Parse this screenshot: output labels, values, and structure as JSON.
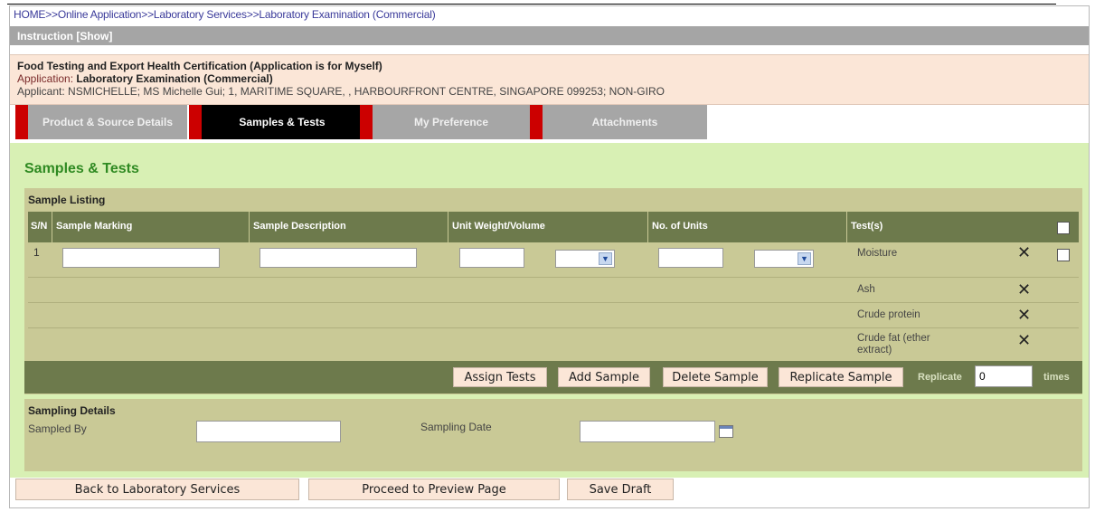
{
  "breadcrumb": "HOME>>Online Application>>Laboratory Services>>Laboratory Examination (Commercial)",
  "instruction_bar": "Instruction [Show]",
  "app_info": {
    "title": "Food Testing and Export Health Certification (Application is for Myself)",
    "application_label": "Application: ",
    "application_value": "Laboratory Examination (Commercial)",
    "applicant": "Applicant: NSMICHELLE; MS Michelle Gui; 1, MARITIME SQUARE, , HARBOURFRONT CENTRE, SINGAPORE 099253; NON-GIRO"
  },
  "tabs": [
    {
      "label": "Product & Source Details",
      "active": false
    },
    {
      "label": "Samples & Tests",
      "active": true
    },
    {
      "label": "My Preference",
      "active": false
    },
    {
      "label": "Attachments",
      "active": false
    }
  ],
  "section_title": "Samples & Tests",
  "sample_listing": {
    "legend": "Sample Listing",
    "columns": [
      "S/N",
      "Sample Marking",
      "Sample Description",
      "Unit Weight/Volume",
      "No. of Units",
      "Test(s)"
    ],
    "rows": [
      {
        "sn": "1",
        "sample_marking": "",
        "sample_description": "",
        "unit_weight": "",
        "unit_weight_unit": "",
        "no_of_units": "",
        "no_of_units_unit": "",
        "tests": [
          "Moisture",
          "Ash",
          "Crude protein",
          "Crude fat (ether extract)"
        ]
      }
    ]
  },
  "actions": {
    "assign_tests": "Assign Tests",
    "add_sample": "Add Sample",
    "delete_sample": "Delete Sample",
    "replicate_sample": "Replicate Sample",
    "replicate_label": "Replicate",
    "replicate_value": "0",
    "times_label": "times"
  },
  "sampling_details": {
    "legend": "Sampling Details",
    "sampled_by_label": "Sampled By",
    "sampled_by_value": "",
    "sampling_date_label": "Sampling Date",
    "sampling_date_value": ""
  },
  "footer": {
    "back": "Back to Laboratory Services",
    "proceed": "Proceed to Preview Page",
    "save_draft": "Save Draft"
  },
  "icons": {
    "remove_test": "close-x-icon",
    "dropdown": "chevron-down-icon",
    "calendar": "calendar-icon"
  },
  "colors": {
    "tab_active": "#000000",
    "tab_inactive": "#a6a6a6",
    "tab_marker": "#cc0000",
    "content_bg": "#d8f0b4",
    "panel_bg": "#c9c996",
    "header_bg": "#6d7a4c",
    "button_bg": "#fbe6d7",
    "section_title": "#2f8a22"
  }
}
